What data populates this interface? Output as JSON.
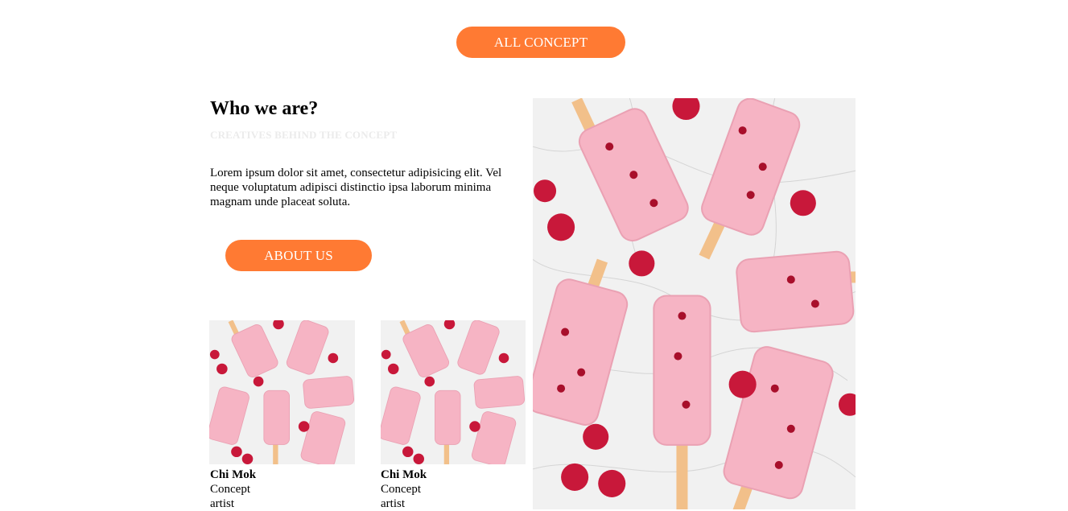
{
  "buttons": {
    "all_concept": "ALL CONCEPT",
    "about_us": "ABOUT US"
  },
  "about": {
    "heading": "Who we are?",
    "subtitle": "CREATIVES BEHIND THE CONCEPT",
    "body": "Lorem ipsum dolor sit amet, consectetur adipisicing elit. Vel neque voluptatum adipisci distinctio ipsa laborum minima magnam unde placeat soluta."
  },
  "team": [
    {
      "name": "Chi Mok",
      "role_line1": "Concept",
      "role_line2": "artist"
    },
    {
      "name": "Chi Mok",
      "role_line1": "Concept",
      "role_line2": "artist"
    }
  ],
  "colors": {
    "accent": "#ff7a33",
    "subtitle": "#ebebeb",
    "popsicle": "#f6b4c4",
    "raspberry": "#c8183a",
    "stick": "#f2c08a",
    "marble": "#f1f1f1"
  }
}
